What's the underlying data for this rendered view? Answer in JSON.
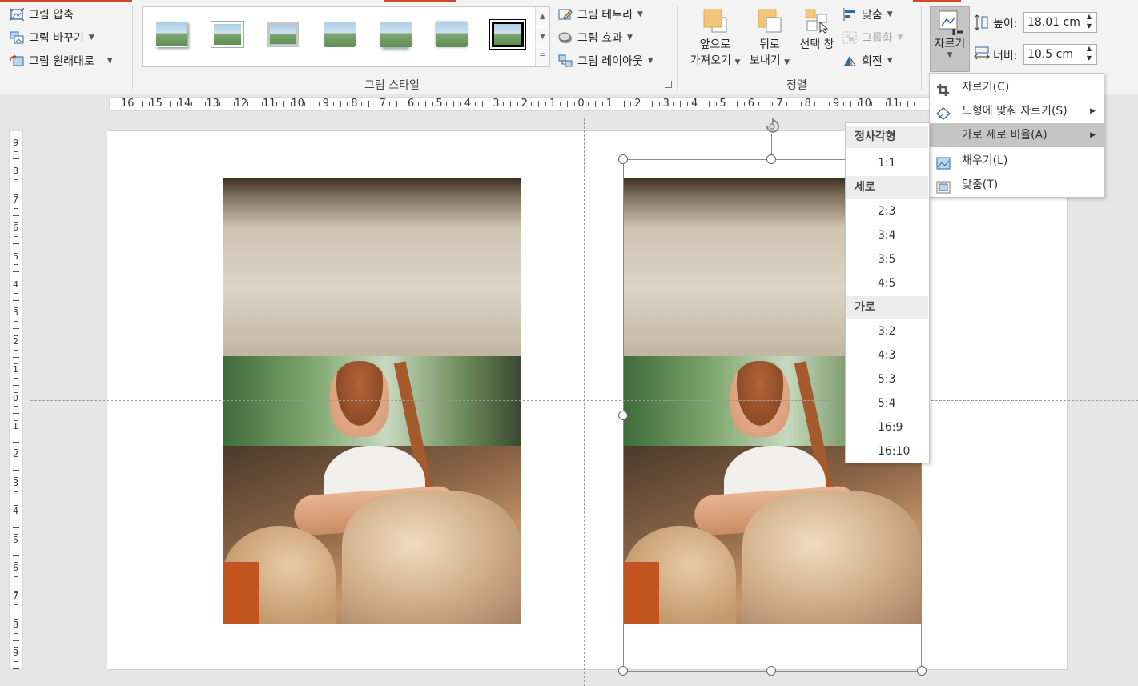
{
  "ribbon": {
    "adjust": {
      "compress": "그림 압축",
      "change": "그림 바꾸기",
      "reset": "그림 원래대로"
    },
    "styles": {
      "group_label": "그림 스타일",
      "border": "그림 테두리",
      "effects": "그림 효과",
      "layout": "그림 레이아웃"
    },
    "arrange": {
      "group_label": "정렬",
      "bring_forward_line1": "앞으로",
      "bring_forward_line2": "가져오기",
      "send_backward_line1": "뒤로",
      "send_backward_line2": "보내기",
      "selection_pane": "선택 창",
      "align": "맞춤",
      "group": "그룹화",
      "rotate": "회전"
    },
    "size": {
      "crop": "자르기",
      "height_label": "높이:",
      "height_value": "18.01 cm",
      "width_label": "너비:",
      "width_value": "10.5 cm"
    }
  },
  "rulers": {
    "horizontal": [
      "16",
      "15",
      "14",
      "13",
      "12",
      "11",
      "10",
      "9",
      "8",
      "7",
      "6",
      "5",
      "4",
      "3",
      "2",
      "1",
      "0",
      "1",
      "2",
      "3",
      "4",
      "5",
      "6",
      "7",
      "8",
      "9",
      "10",
      "11"
    ],
    "vertical": [
      "9",
      "8",
      "7",
      "6",
      "5",
      "4",
      "3",
      "2",
      "1",
      "0",
      "1",
      "2",
      "3",
      "4",
      "5",
      "6",
      "7",
      "8",
      "9"
    ]
  },
  "crop_menu": {
    "items": [
      {
        "label": "자르기(C)",
        "icon": "crop-icon",
        "submenu": false
      },
      {
        "label": "도형에 맞춰 자르기(S)",
        "icon": "shape-crop-icon",
        "submenu": true
      },
      {
        "label": "가로 세로 비율(A)",
        "icon": "",
        "submenu": true
      },
      {
        "label": "채우기(L)",
        "icon": "fill-icon",
        "submenu": false
      },
      {
        "label": "맞춤(T)",
        "icon": "fit-icon",
        "submenu": false
      }
    ]
  },
  "aspect_menu": {
    "square_header": "정사각형",
    "square": [
      "1:1"
    ],
    "portrait_header": "세로",
    "portrait": [
      "2:3",
      "3:4",
      "3:5",
      "4:5"
    ],
    "landscape_header": "가로",
    "landscape": [
      "3:2",
      "4:3",
      "5:3",
      "5:4",
      "16:9",
      "16:10"
    ]
  },
  "colors": {
    "accent": "#d24726",
    "hover": "#c5c5c5",
    "ribbon_bg": "#f3f3f3"
  }
}
